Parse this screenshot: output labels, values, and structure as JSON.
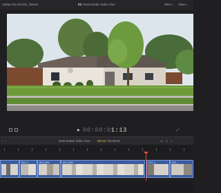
{
  "viewer_bar": {
    "format": "1080p HD 29.97p, Stereo",
    "title": "Real Estate Video Tour",
    "zoom": "38%",
    "view_label": "View"
  },
  "transport": {
    "timecode_dim": "00:00:0",
    "timecode_main": "1:13"
  },
  "timeline_header": {
    "project": "Real Estate Video Tour",
    "position": "00:16",
    "duration": "00:49:03"
  },
  "clips": [
    {
      "label": ""
    },
    {
      "label": "MVI_0..."
    },
    {
      "label": "MVI_0434"
    },
    {
      "label": "MVI_0435"
    },
    {
      "label": "MVI_0..."
    },
    {
      "label": "MVI_..."
    }
  ],
  "colors": {
    "clip_fill": "#3a5ba0",
    "playhead": "#e05040",
    "accent_time": "#e0c25a"
  }
}
